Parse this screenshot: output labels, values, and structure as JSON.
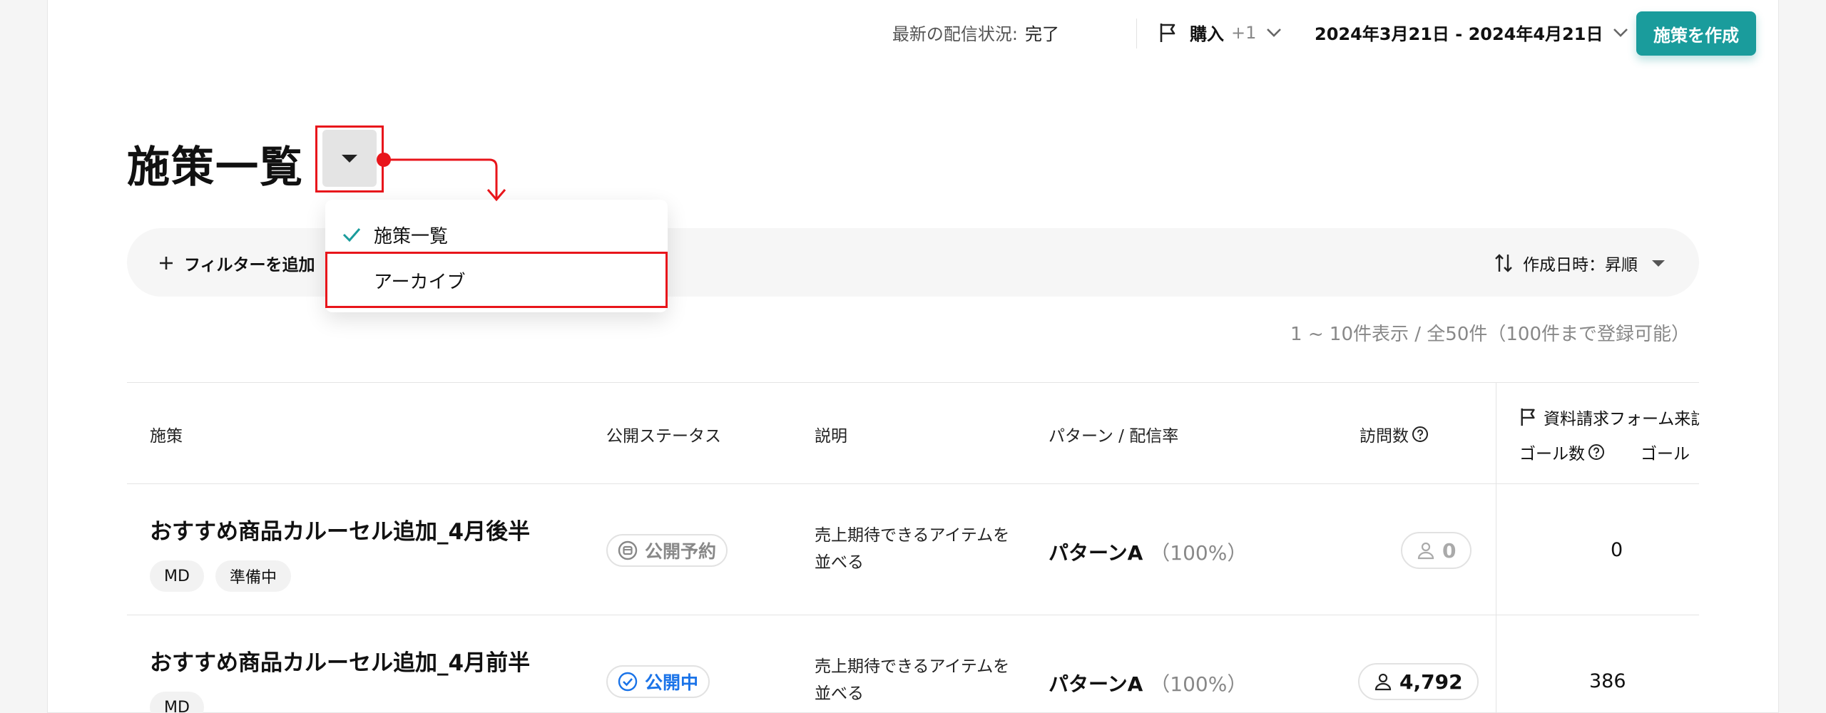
{
  "colors": {
    "accent": "#1a9c9c",
    "annotation": "#e8151b",
    "status_live": "#1a73e8",
    "status_scheduled": "#888888"
  },
  "header": {
    "status_label": "最新の配信状況:",
    "status_value": "完了",
    "goal_name": "購入",
    "goal_extra": "+1",
    "date_range": "2024年3月21日 - 2024年4月21日",
    "create_button": "施策を作成"
  },
  "page": {
    "title": "施策一覧",
    "count_text": "1 ~ 10件表示 / 全50件（100件まで登録可能）"
  },
  "filter": {
    "add_label": "フィルターを追加",
    "sort_label": "作成日時：昇順"
  },
  "dropdown": {
    "items": [
      {
        "label": "施策一覧",
        "selected": true
      },
      {
        "label": "アーカイブ",
        "selected": false
      }
    ]
  },
  "table": {
    "headers": {
      "campaign": "施策",
      "status": "公開ステータス",
      "description": "説明",
      "pattern": "パターン / 配信率",
      "visits": "訪問数",
      "goal_group": "資料請求フォーム来訪",
      "goal_count": "ゴール数",
      "goal_rate": "ゴール"
    },
    "rows": [
      {
        "name": "おすすめ商品カルーセル追加_4月後半",
        "tags": [
          "MD",
          "準備中"
        ],
        "status": "公開予約",
        "description": "売上期待できるアイテムを並べる",
        "pattern": "パターンA",
        "pattern_pct": "（100%）",
        "visits": "0",
        "goal_count": "0"
      },
      {
        "name": "おすすめ商品カルーセル追加_4月前半",
        "tags": [
          "MD"
        ],
        "status": "公開中",
        "description": "売上期待できるアイテムを並べる",
        "pattern": "パターンA",
        "pattern_pct": "（100%）",
        "visits": "4,792",
        "goal_count": "386"
      }
    ]
  }
}
